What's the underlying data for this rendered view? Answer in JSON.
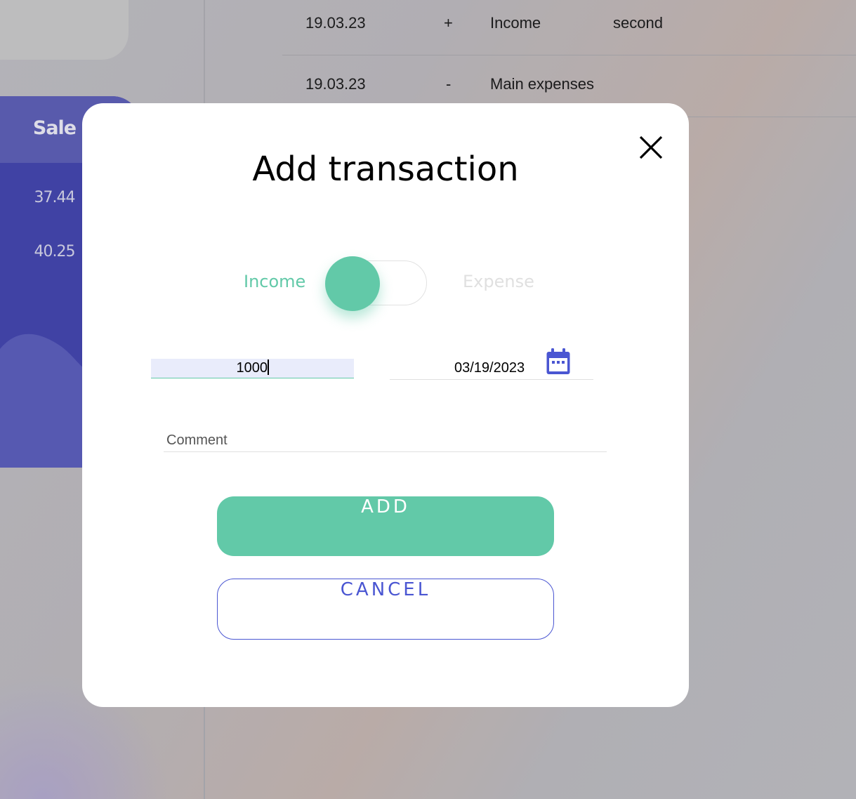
{
  "background": {
    "stats_panel": {
      "title": "Sale",
      "values": [
        "37.44",
        "40.25"
      ]
    },
    "transactions": [
      {
        "date": "19.03.23",
        "type": "+",
        "category": "Income",
        "comment": "second"
      },
      {
        "date": "19.03.23",
        "type": "-",
        "category": "Main expenses",
        "comment": ""
      }
    ]
  },
  "modal": {
    "title": "Add transaction",
    "close_icon": "close-icon",
    "toggle": {
      "income_label": "Income",
      "expense_label": "Expense",
      "selected": "Income"
    },
    "amount": {
      "value": "1000"
    },
    "date": {
      "value": "03/19/2023",
      "icon": "calendar-icon"
    },
    "comment": {
      "placeholder": "Comment",
      "value": ""
    },
    "add_label": "ADD",
    "cancel_label": "CANCEL"
  },
  "colors": {
    "accent_green": "#62c9a8",
    "accent_blue": "#4a56d2",
    "stats_panel_bg": "#3c3ea8",
    "inactive_label": "#e0e0e0"
  }
}
